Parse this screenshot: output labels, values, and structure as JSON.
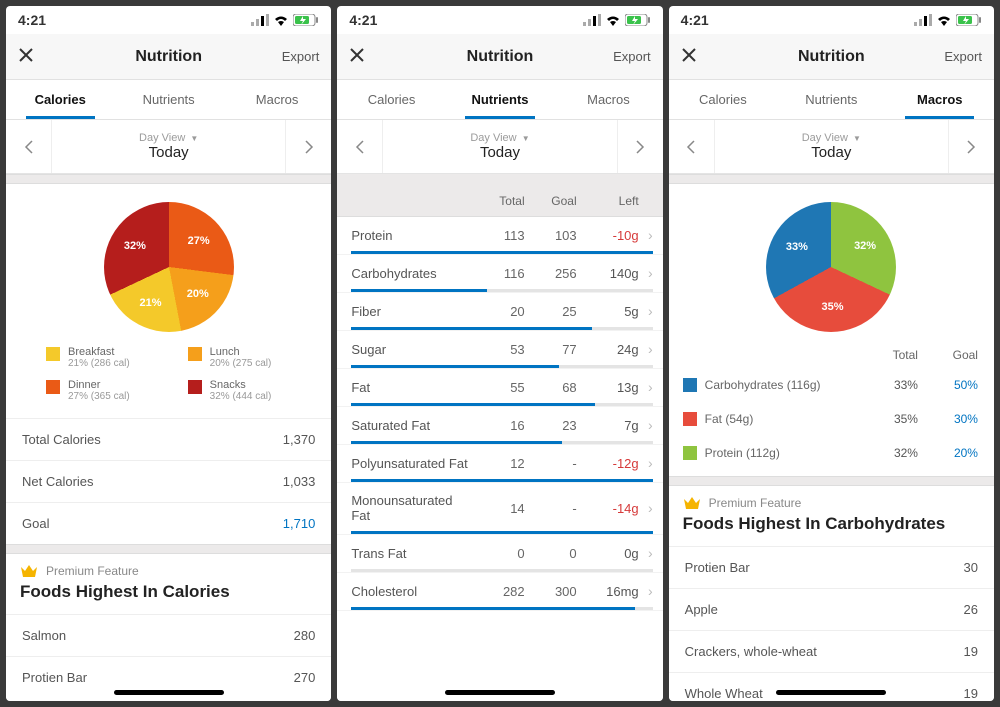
{
  "status_time": "4:21",
  "header": {
    "title": "Nutrition",
    "export": "Export"
  },
  "tabs": [
    "Calories",
    "Nutrients",
    "Macros"
  ],
  "date_nav": {
    "mode": "Day View",
    "label": "Today"
  },
  "premium_label": "Premium Feature",
  "calories": {
    "legend": [
      {
        "name": "Breakfast",
        "sub": "21% (286 cal)",
        "color": "#f4c92a"
      },
      {
        "name": "Lunch",
        "sub": "20% (275 cal)",
        "color": "#f59f1b"
      },
      {
        "name": "Dinner",
        "sub": "27% (365 cal)",
        "color": "#ea5a16"
      },
      {
        "name": "Snacks",
        "sub": "32% (444 cal)",
        "color": "#b51e1c"
      }
    ],
    "summary": [
      {
        "label": "Total Calories",
        "value": "1,370"
      },
      {
        "label": "Net Calories",
        "value": "1,033"
      },
      {
        "label": "Goal",
        "value": "1,710",
        "blue": true
      }
    ],
    "highest_title": "Foods Highest In Calories",
    "highest": [
      {
        "name": "Salmon",
        "value": "280"
      },
      {
        "name": "Protien Bar",
        "value": "270"
      }
    ]
  },
  "nutrients": {
    "head": {
      "total": "Total",
      "goal": "Goal",
      "left": "Left"
    },
    "rows": [
      {
        "name": "Protein",
        "total": "113",
        "goal": "103",
        "left": "-10g",
        "neg": true,
        "pct": 100
      },
      {
        "name": "Carbohydrates",
        "total": "116",
        "goal": "256",
        "left": "140g",
        "neg": false,
        "pct": 45
      },
      {
        "name": "Fiber",
        "total": "20",
        "goal": "25",
        "left": "5g",
        "neg": false,
        "pct": 80
      },
      {
        "name": "Sugar",
        "total": "53",
        "goal": "77",
        "left": "24g",
        "neg": false,
        "pct": 69
      },
      {
        "name": "Fat",
        "total": "55",
        "goal": "68",
        "left": "13g",
        "neg": false,
        "pct": 81
      },
      {
        "name": "Saturated Fat",
        "total": "16",
        "goal": "23",
        "left": "7g",
        "neg": false,
        "pct": 70
      },
      {
        "name": "Polyunsaturated Fat",
        "total": "12",
        "goal": "-",
        "left": "-12g",
        "neg": true,
        "pct": 100
      },
      {
        "name": "Monounsaturated Fat",
        "total": "14",
        "goal": "-",
        "left": "-14g",
        "neg": true,
        "pct": 100
      },
      {
        "name": "Trans Fat",
        "total": "0",
        "goal": "0",
        "left": "0g",
        "neg": false,
        "pct": 0
      },
      {
        "name": "Cholesterol",
        "total": "282",
        "goal": "300",
        "left": "16mg",
        "neg": false,
        "pct": 94
      }
    ]
  },
  "macros": {
    "head": {
      "total": "Total",
      "goal": "Goal"
    },
    "rows": [
      {
        "name": "Carbohydrates (116g)",
        "total": "33%",
        "goal": "50%",
        "color": "#1f77b4"
      },
      {
        "name": "Fat (54g)",
        "total": "35%",
        "goal": "30%",
        "color": "#e74c3c"
      },
      {
        "name": "Protein (112g)",
        "total": "32%",
        "goal": "20%",
        "color": "#8fc43f"
      }
    ],
    "highest_title": "Foods Highest In Carbohydrates",
    "highest": [
      {
        "name": "Protien Bar",
        "value": "30"
      },
      {
        "name": "Apple",
        "value": "26"
      },
      {
        "name": "Crackers, whole-wheat",
        "value": "19"
      },
      {
        "name": "Whole Wheat",
        "value": "19"
      }
    ]
  },
  "chart_data": [
    {
      "type": "pie",
      "title": "Calories by Meal",
      "series": [
        {
          "name": "Breakfast",
          "value": 21,
          "color": "#f4c92a"
        },
        {
          "name": "Lunch",
          "value": 20,
          "color": "#f59f1b"
        },
        {
          "name": "Dinner",
          "value": 27,
          "color": "#ea5a16"
        },
        {
          "name": "Snacks",
          "value": 32,
          "color": "#b51e1c"
        }
      ]
    },
    {
      "type": "pie",
      "title": "Macros",
      "series": [
        {
          "name": "Carbohydrates",
          "value": 33,
          "color": "#1f77b4"
        },
        {
          "name": "Fat",
          "value": 35,
          "color": "#e74c3c"
        },
        {
          "name": "Protein",
          "value": 32,
          "color": "#8fc43f"
        }
      ]
    }
  ]
}
